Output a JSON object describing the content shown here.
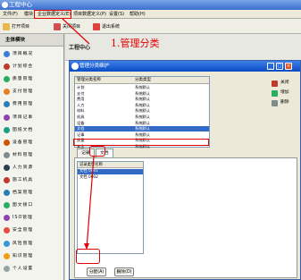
{
  "window": {
    "title": "工程中心"
  },
  "menu": [
    {
      "label": "文件(F)"
    },
    {
      "label": "模块"
    },
    {
      "label": "企业数据定义(E)"
    },
    {
      "label": "项目数据定义(P)"
    },
    {
      "label": "设置(S)"
    },
    {
      "label": "帮助(H)"
    }
  ],
  "toolbar": [
    {
      "label": "打开项目"
    },
    {
      "label": "关闭项目"
    },
    {
      "label": "退出系统"
    }
  ],
  "sidebar": {
    "header": "主体模块",
    "items": [
      {
        "label": "项目概况",
        "color": "#3a7bd5"
      },
      {
        "label": "计划综合",
        "color": "#c0392b"
      },
      {
        "label": "质量管理",
        "color": "#27ae60"
      },
      {
        "label": "支付管理",
        "color": "#e67e22"
      },
      {
        "label": "费用管理",
        "color": "#2980b9"
      },
      {
        "label": "项目记事",
        "color": "#8e44ad"
      },
      {
        "label": "图纸文档",
        "color": "#16a085"
      },
      {
        "label": "设备管理",
        "color": "#d35400"
      },
      {
        "label": "材料管理",
        "color": "#7f8c8d"
      },
      {
        "label": "人力资源",
        "color": "#2c3e50"
      },
      {
        "label": "施工机具",
        "color": "#c0392b"
      },
      {
        "label": "档案管理",
        "color": "#2980b9"
      },
      {
        "label": "图文接口",
        "color": "#27ae60"
      },
      {
        "label": "ISO管理",
        "color": "#8e44ad"
      },
      {
        "label": "安全管理",
        "color": "#e74c3c"
      },
      {
        "label": "风险管理",
        "color": "#3498db"
      },
      {
        "label": "知识管理",
        "color": "#f39c12"
      },
      {
        "label": "个人设置",
        "color": "#95a5a6"
      }
    ]
  },
  "workarea": {
    "tab_title": "工程中心"
  },
  "annotation": {
    "step_label": "1.管理分类"
  },
  "dialog": {
    "title": "管理分类维护",
    "columns": [
      "管理分类名称",
      "分类类型"
    ],
    "rows": [
      {
        "name": "计划",
        "type": "系统默认"
      },
      {
        "name": "支付",
        "type": "系统默认"
      },
      {
        "name": "费用",
        "type": "系统默认"
      },
      {
        "name": "人力",
        "type": "系统默认"
      },
      {
        "name": "材料",
        "type": "系统默认"
      },
      {
        "name": "机具",
        "type": "系统默认"
      },
      {
        "name": "设备",
        "type": "系统默认"
      },
      {
        "name": "文档",
        "type": "系统默认",
        "selected": true
      },
      {
        "name": "记事",
        "type": "系统默认"
      },
      {
        "name": "质量",
        "type": "系统默认"
      },
      {
        "name": "安全",
        "type": "系统默认"
      }
    ],
    "side_buttons": [
      {
        "label": "关闭",
        "color": "#c0392b"
      },
      {
        "label": "增加",
        "color": "#27ae60"
      },
      {
        "label": "删除",
        "color": "#7f8c8d"
      }
    ],
    "tabs": [
      {
        "label": "记录"
      },
      {
        "label": "文档",
        "active": true
      }
    ],
    "list": {
      "header": "记录类型名称",
      "items": [
        {
          "label": "文档 0001",
          "selected": true
        },
        {
          "label": "文档 0002"
        }
      ]
    },
    "buttons": {
      "add": "分配(A)",
      "delete": "删除(D)"
    }
  }
}
